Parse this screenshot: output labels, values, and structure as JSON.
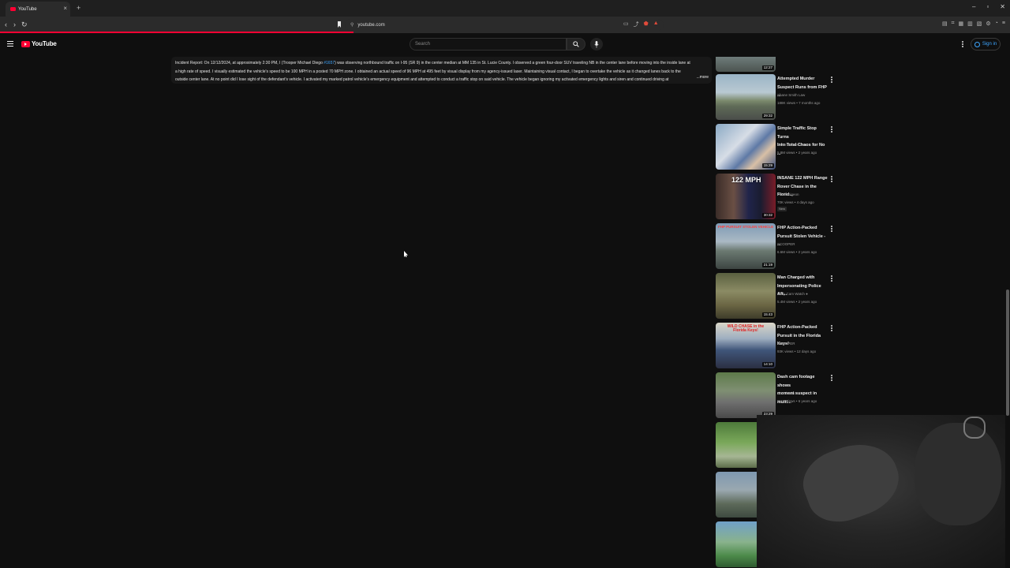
{
  "browser": {
    "tab_title": "YouTube",
    "new_tab_symbol": "+",
    "tab_close_symbol": "×",
    "url": "youtube.com",
    "window_controls": [
      "–",
      "▫",
      "✕"
    ]
  },
  "loading_progress": 0.35,
  "header": {
    "logo_text": "YouTube",
    "search_placeholder": "Search",
    "sign_in_label": "Sign in"
  },
  "description": {
    "line1_a": "Incident Report: On 12/12/2024, at approximately 2:30 PM, I (Trooper Michael Diego ",
    "line1_link": "#1657",
    "line1_b": ") was observing northbound traffic on I-95 (SR 9) in the center median at MM 135 in St. Lucie County. I observed a green four-door SUV traveling NB in the center lane before moving into the inside lane at",
    "line2": "a high rate of speed. I visually estimated the vehicle's speed to be 100 MPH in a posted 70 MPH zone. I obtained an actual speed of 96 MPH at 495 feet by visual display from my agency-issued laser. Maintaining visual contact, I began to overtake the vehicle as it changed lanes back to the",
    "line3": "outside center lane. At no point did I lose sight of the defendant's vehicle. I activated my marked patrol vehicle's emergency equipment and attempted to conduct a traffic stop on said vehicle. The vehicle began ignoring my activated emergency lights and siren and continued driving at",
    "more_label": "...more"
  },
  "top_partial_duration": "12:27",
  "videos": [
    {
      "title_lines": [
        "Attempted Murder",
        "Suspect Runs from FHP ..."
      ],
      "channel": "Shane Smith Law",
      "meta": "188K views • 7 months ago",
      "duration": "29:32",
      "overlay": ""
    },
    {
      "title_lines": [
        "Simple Traffic Stop Turns",
        "Into Total Chaos for No ..."
      ],
      "channel": "Crime Scene Cam",
      "meta": "5.8M views • 2 years ago",
      "duration": "15:29",
      "overlay": ""
    },
    {
      "title_lines": [
        "INSANE 122 MPH Range",
        "Rover Chase in the Florid..."
      ],
      "channel": "Public Pigeon",
      "meta": "70K views • 4 days ago",
      "duration": "30:32",
      "badge": "New",
      "overlay": "122 MPH"
    },
    {
      "title_lines": [
        "FHP Action-Packed",
        "Pursuit Stolen Vehicle - ..."
      ],
      "channel": "SCOOPER",
      "meta": "6.6M views • 2 years ago",
      "duration": "21:19",
      "overlay": "FHP PURSUIT STOLEN VEHICLE"
    },
    {
      "title_lines": [
        "Man Charged with",
        "Impersonating Police Aft..."
      ],
      "channel": "Body Cam Watch",
      "meta": "5.4M views • 2 years ago",
      "duration": "15:43",
      "overlay": ""
    },
    {
      "title_lines": [
        "FHP Action-Packed",
        "Pursuit in the Florida Keys!"
      ],
      "channel": "SCOOPER",
      "meta": "93K views • 12 days ago",
      "duration": "14:10",
      "overlay": "WILD CHASE in the Florida Keys!"
    },
    {
      "title_lines": [
        "Dash cam footage shows",
        "moment suspect in multi..."
      ],
      "channel": "cbsmiamitv",
      "meta": "811K views • 6 years ago",
      "duration": "23:29",
      "overlay": ""
    }
  ],
  "colors": {
    "accent": "#ff0033",
    "link": "#3ea6ff",
    "background": "#0f0f0f"
  }
}
